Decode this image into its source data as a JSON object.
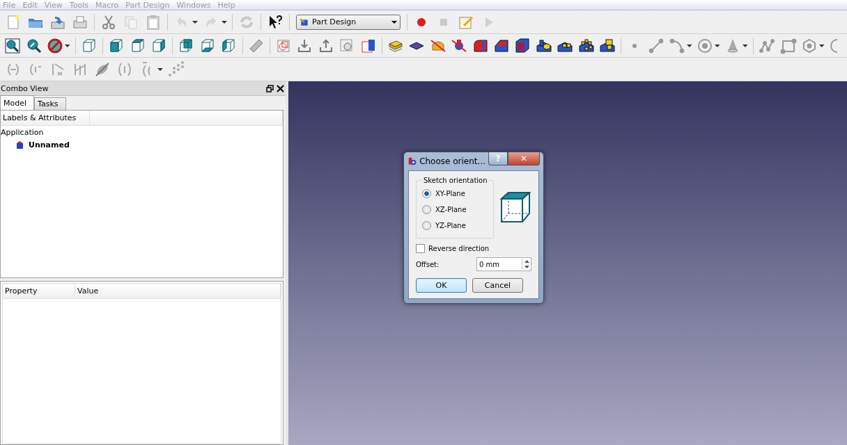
{
  "menu": [
    {
      "label": "File",
      "disabled": true
    },
    {
      "label": "Edit",
      "disabled": true
    },
    {
      "label": "View",
      "disabled": true
    },
    {
      "label": "Tools",
      "disabled": true
    },
    {
      "label": "Macro",
      "disabled": true
    },
    {
      "label": "Part Design",
      "disabled": true
    },
    {
      "label": "Windows",
      "disabled": true
    },
    {
      "label": "Help",
      "disabled": true
    }
  ],
  "workbench": {
    "value": "Part Design"
  },
  "combo_view": {
    "title": "Combo View",
    "tabs": [
      {
        "label": "Model",
        "selected": true
      },
      {
        "label": "Tasks",
        "selected": false
      }
    ],
    "tree_header": "Labels & Attributes",
    "tree": [
      {
        "label": "Application",
        "children": [
          {
            "label": "Unnamed"
          }
        ]
      }
    ],
    "property_columns": [
      "Property",
      "Value"
    ]
  },
  "dialog": {
    "title": "Choose orient...",
    "help": "?",
    "close": "✕",
    "group_title": "Sketch orientation",
    "options": [
      {
        "label": "XY-Plane",
        "selected": true
      },
      {
        "label": "XZ-Plane",
        "selected": false
      },
      {
        "label": "YZ-Plane",
        "selected": false
      }
    ],
    "reverse": {
      "label": "Reverse direction",
      "checked": false
    },
    "offset": {
      "label": "Offset:",
      "value": "0 mm"
    },
    "buttons": [
      {
        "label": "OK",
        "default": true
      },
      {
        "label": "Cancel",
        "default": false
      }
    ]
  }
}
